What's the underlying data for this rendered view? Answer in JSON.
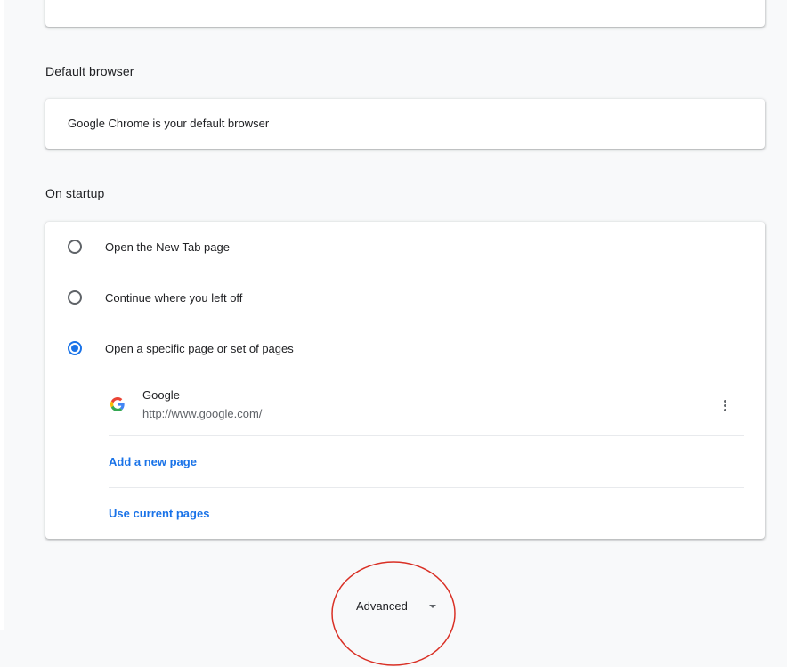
{
  "default_browser": {
    "section_title": "Default browser",
    "status_text": "Google Chrome is your default browser"
  },
  "on_startup": {
    "section_title": "On startup",
    "options": [
      {
        "label": "Open the New Tab page",
        "selected": false
      },
      {
        "label": "Continue where you left off",
        "selected": false
      },
      {
        "label": "Open a specific page or set of pages",
        "selected": true
      }
    ],
    "pages": [
      {
        "name": "Google",
        "url": "http://www.google.com/",
        "icon": "google-favicon-icon"
      }
    ],
    "add_page_label": "Add a new page",
    "use_current_label": "Use current pages"
  },
  "advanced": {
    "label": "Advanced",
    "icon": "arrow-drop-down-icon"
  },
  "colors": {
    "accent": "#1a73e8",
    "annotation": "#d93025",
    "background": "#f8f9fa"
  }
}
